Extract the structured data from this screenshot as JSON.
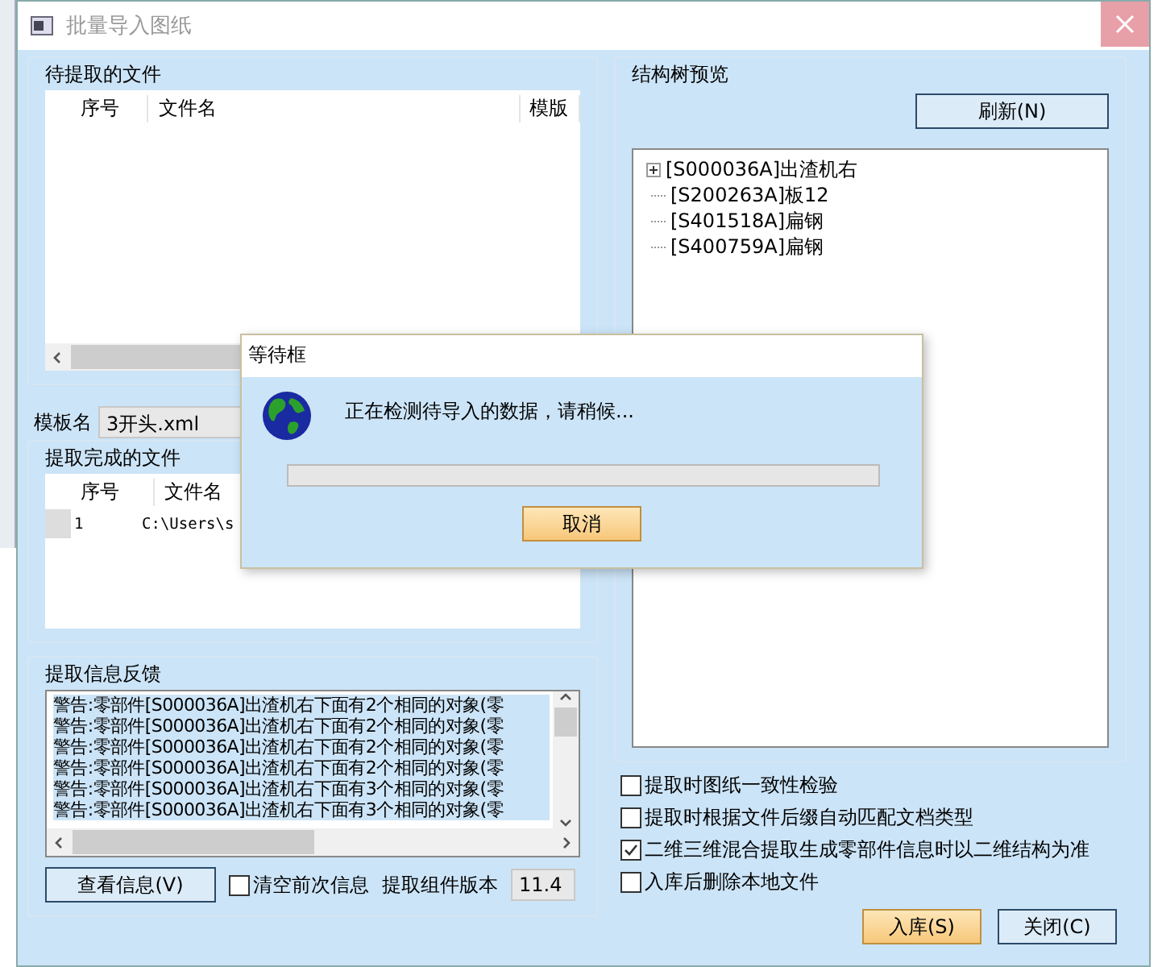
{
  "window": {
    "title": "批量导入图纸"
  },
  "pending_files": {
    "title": "待提取的文件",
    "columns": [
      "序号",
      "文件名",
      "模版"
    ]
  },
  "template": {
    "label": "模板名",
    "value": "3开头.xml"
  },
  "completed_files": {
    "title": "提取完成的文件",
    "columns": [
      "序号",
      "文件名"
    ],
    "rows": [
      {
        "index": "1",
        "file": "C:\\Users\\s"
      }
    ]
  },
  "feedback": {
    "title": "提取信息反馈",
    "lines": [
      "警告:零部件[S000036A]出渣机右下面有2个相同的对象(零",
      "警告:零部件[S000036A]出渣机右下面有2个相同的对象(零",
      "警告:零部件[S000036A]出渣机右下面有2个相同的对象(零",
      "警告:零部件[S000036A]出渣机右下面有2个相同的对象(零",
      "警告:零部件[S000036A]出渣机右下面有3个相同的对象(零",
      "警告:零部件[S000036A]出渣机右下面有3个相同的对象(零"
    ],
    "view_button": "查看信息(V)",
    "clear_option": {
      "label": "清空前次信息",
      "checked": false
    },
    "version_label": "提取组件版本",
    "version": "11.4"
  },
  "tree_preview": {
    "title": "结构树预览",
    "refresh_button": "刷新(N)",
    "items": [
      {
        "label": "[S000036A]出渣机右",
        "kind": "group",
        "expanded": false
      },
      {
        "label": "[S200263A]板12",
        "kind": "leaf"
      },
      {
        "label": "[S401518A]扁钢",
        "kind": "leaf"
      },
      {
        "label": "[S400759A]扁钢",
        "kind": "leaf"
      }
    ]
  },
  "options": [
    {
      "label": "提取时图纸一致性检验",
      "checked": false
    },
    {
      "label": "提取时根据文件后缀自动匹配文档类型",
      "checked": false
    },
    {
      "label": "二维三维混合提取生成零部件信息时以二维结构为准",
      "checked": true
    },
    {
      "label": "入库后删除本地文件",
      "checked": false
    }
  ],
  "buttons": [
    {
      "label": "入库(S)",
      "selected": true
    },
    {
      "label": "关闭(C)",
      "selected": false
    }
  ],
  "wait_dialog": {
    "title": "等待框",
    "message": "正在检测待导入的数据，请稍候...",
    "level": 0,
    "cancel_button": "取消"
  }
}
